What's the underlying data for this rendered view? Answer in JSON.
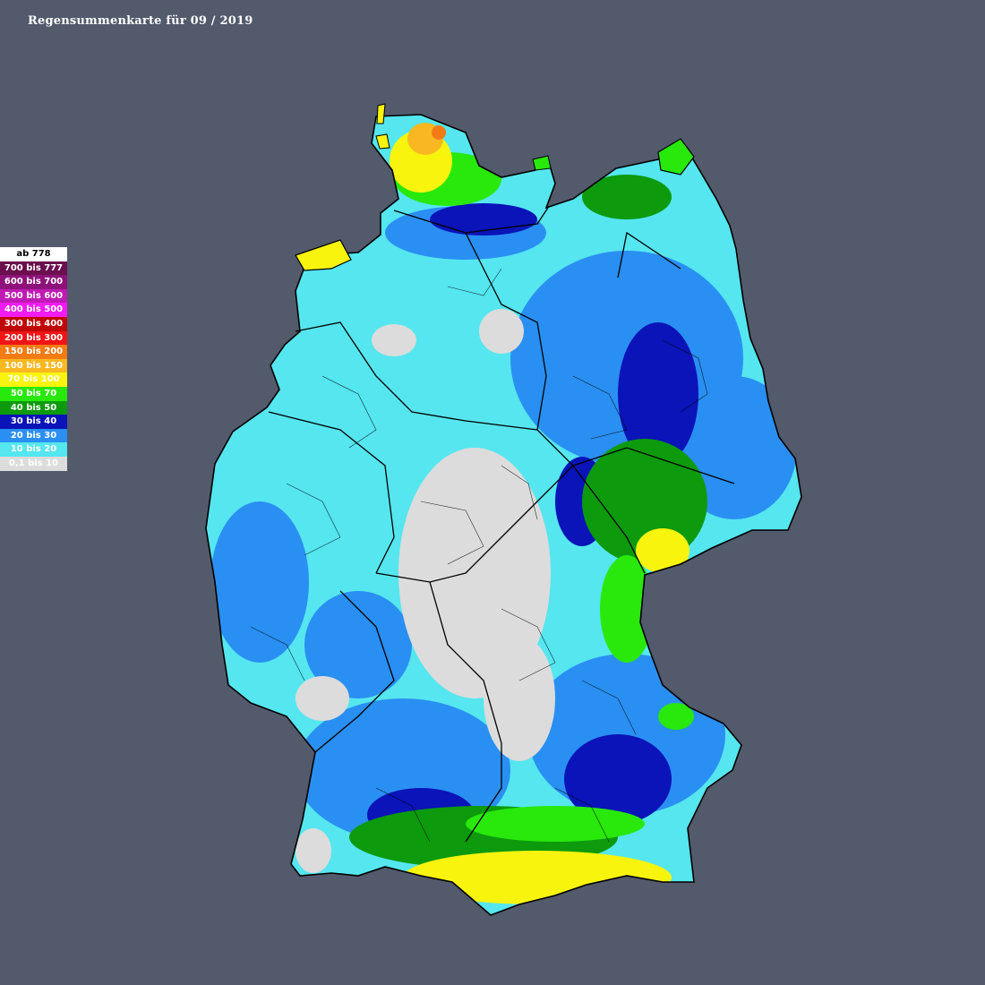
{
  "title": "Regensummenkarte für 09 / 2019",
  "legend": [
    {
      "label": "ab 778",
      "color": "#ffffff",
      "text": "#000000"
    },
    {
      "label": "700 bis 777",
      "color": "#6b0f4e",
      "text": "#ffffff"
    },
    {
      "label": "600 bis 700",
      "color": "#8d137a",
      "text": "#ffffff"
    },
    {
      "label": "500 bis 600",
      "color": "#c01ab5",
      "text": "#ffffff"
    },
    {
      "label": "400 bis 500",
      "color": "#f21bf2",
      "text": "#ffffff"
    },
    {
      "label": "300 bis 400",
      "color": "#c00707",
      "text": "#ffffff"
    },
    {
      "label": "200 bis 300",
      "color": "#f01515",
      "text": "#ffffff"
    },
    {
      "label": "150 bis 200",
      "color": "#f47b14",
      "text": "#ffffff"
    },
    {
      "label": "100 bis 150",
      "color": "#f9b821",
      "text": "#ffffff"
    },
    {
      "label": "70 bis 100",
      "color": "#f8f40e",
      "text": "#ffffff"
    },
    {
      "label": "50 bis 70",
      "color": "#29e80c",
      "text": "#ffffff"
    },
    {
      "label": "40 bis 50",
      "color": "#0d9a0d",
      "text": "#ffffff"
    },
    {
      "label": "30 bis 40",
      "color": "#0a14b8",
      "text": "#ffffff"
    },
    {
      "label": "20 bis 30",
      "color": "#2a8ff2",
      "text": "#ffffff"
    },
    {
      "label": "10 bis 20",
      "color": "#55e6ef",
      "text": "#ffffff"
    },
    {
      "label": "0,1 bis 10",
      "color": "#dcdcdc",
      "text": "#ffffff"
    }
  ]
}
